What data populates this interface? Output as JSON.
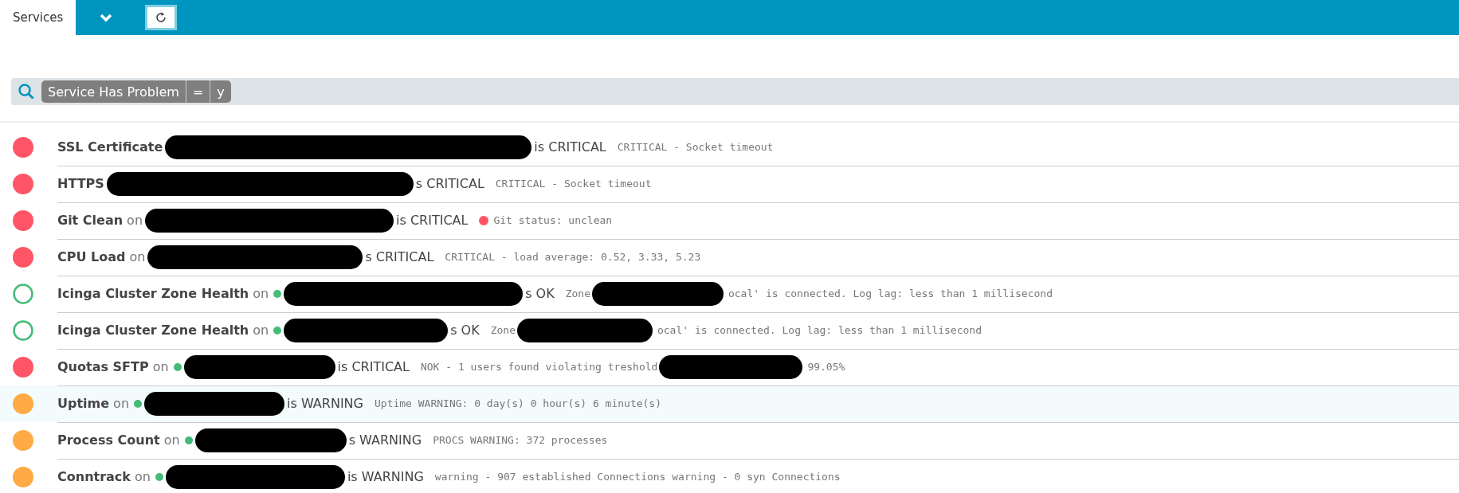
{
  "tabs": [
    {
      "label": "Services",
      "selected": true
    }
  ],
  "filter": {
    "column": "Service Has Problem",
    "operator": "=",
    "value": "y"
  },
  "services": [
    {
      "kind": "critical",
      "selected": false,
      "name": "SSL Certificate",
      "host_dot": false,
      "state_text": "is CRITICAL",
      "output": [
        "CRITICAL - Socket timeout"
      ]
    },
    {
      "kind": "critical",
      "selected": false,
      "name": "HTTPS",
      "host_dot": false,
      "state_text": "s CRITICAL",
      "output": [
        "CRITICAL - Socket timeout"
      ]
    },
    {
      "kind": "critical",
      "selected": false,
      "name": "Git Clean",
      "on": "on",
      "host_dot": false,
      "state_text": "is CRITICAL",
      "color": "#ff5566",
      "output": [
        "Git status: unclean"
      ]
    },
    {
      "kind": "critical",
      "selected": false,
      "name": "CPU Load",
      "on": "on",
      "host_dot": false,
      "state_text": "s CRITICAL",
      "output": [
        "CRITICAL - load average: 0.52, 3.33, 5.23"
      ]
    },
    {
      "kind": "ok",
      "selected": false,
      "name": "Icinga Cluster Zone Health",
      "on": "on",
      "host_dot": true,
      "state_text": "s OK",
      "output": [
        "Zone",
        "ocal' is connected. Log lag: less than 1 millisecond"
      ]
    },
    {
      "kind": "ok",
      "selected": false,
      "name": "Icinga Cluster Zone Health",
      "on": "on",
      "host_dot": true,
      "state_text": "s OK",
      "output": [
        "Zone",
        "ocal' is connected. Log lag: less than 1 millisecond"
      ]
    },
    {
      "kind": "critical",
      "selected": false,
      "name": "Quotas SFTP",
      "on": "on",
      "host_dot": true,
      "state_text": "is CRITICAL",
      "output": [
        "NOK - 1 users found violating treshold",
        "99.05%"
      ]
    },
    {
      "kind": "warning",
      "selected": true,
      "name": "Uptime",
      "on": "on",
      "host_dot": true,
      "state_text": "is WARNING",
      "output": [
        "Uptime WARNING: 0 day(s) 0 hour(s) 6 minute(s)"
      ]
    },
    {
      "kind": "warning",
      "selected": false,
      "name": "Process Count",
      "on": "on",
      "host_dot": true,
      "state_text": "s WARNING",
      "output": [
        "PROCS WARNING: 372 processes"
      ]
    },
    {
      "kind": "warning",
      "selected": false,
      "name": "Conntrack",
      "on": "on",
      "host_dot": true,
      "state_text": "is WARNING",
      "output": [
        "warning - 907 established Connections warning - 0 syn Connections"
      ]
    }
  ]
}
